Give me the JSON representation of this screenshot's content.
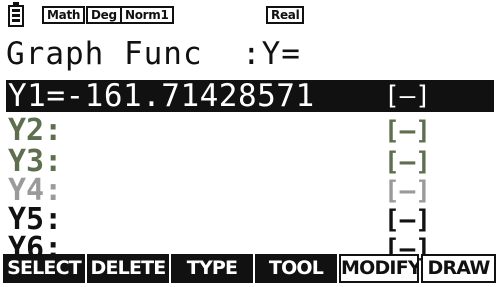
{
  "status_bar": {
    "battery_icon": "battery-icon",
    "mode_badges": [
      "Math",
      "Deg",
      "Norm1"
    ],
    "complex_badge": "Real"
  },
  "title": "Graph Func  :Y=",
  "functions": [
    {
      "label": "Y1=-161.71428571",
      "style": "[—]",
      "selected": true,
      "color": "#ffffff"
    },
    {
      "label": "Y2:",
      "style": "[—]",
      "selected": false,
      "color": "#5d6f4f"
    },
    {
      "label": "Y3:",
      "style": "[—]",
      "selected": false,
      "color": "#5d6f4f"
    },
    {
      "label": "Y4:",
      "style": "[—]",
      "selected": false,
      "color": "#9a9a9a"
    },
    {
      "label": "Y5:",
      "style": "[—]",
      "selected": false,
      "color": "#111111"
    },
    {
      "label": "Y6:",
      "style": "[—]",
      "selected": false,
      "color": "#111111"
    }
  ],
  "function_keys": [
    {
      "label": "SELECT",
      "style": "solid"
    },
    {
      "label": "DELETE",
      "style": "solid"
    },
    {
      "label": "TYPE",
      "style": "solid"
    },
    {
      "label": "TOOL",
      "style": "solid"
    },
    {
      "label": "MODIFY",
      "style": "outline"
    },
    {
      "label": "DRAW",
      "style": "outline"
    }
  ]
}
